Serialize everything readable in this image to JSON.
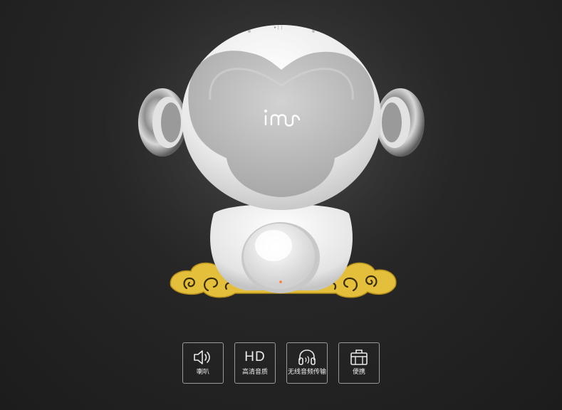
{
  "brand": {
    "logo_text": "imou"
  },
  "features": [
    {
      "icon": "speaker-icon",
      "label": "喇叭"
    },
    {
      "icon": "hd-icon",
      "icon_text": "HD",
      "label": "高清音质"
    },
    {
      "icon": "headphones-icon",
      "label": "无线音频传输"
    },
    {
      "icon": "briefcase-icon",
      "label": "便携"
    }
  ],
  "colors": {
    "background": "#262626",
    "product_white": "#ededed",
    "face_gray": "#b9b9b9",
    "cloud_gold": "#e3bf3c",
    "icon_border": "#9a9a9a"
  }
}
